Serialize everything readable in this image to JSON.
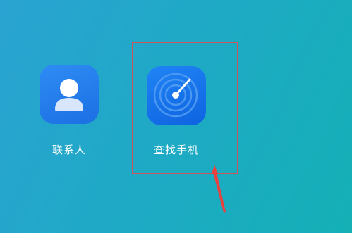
{
  "apps": [
    {
      "label": "联系人",
      "icon": "contacts-person-icon"
    },
    {
      "label": "查找手机",
      "icon": "radar-find-phone-icon"
    }
  ],
  "annotation": {
    "box_color": "#c9565a",
    "arrow_color": "#e8423f"
  },
  "colors": {
    "background_start": "#2aa3d2",
    "background_end": "#14b0b6",
    "icon_blue": "#1b6fe3",
    "label_text": "#ffffff"
  }
}
